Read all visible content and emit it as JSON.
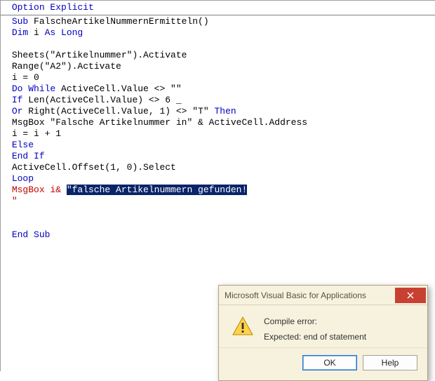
{
  "code": {
    "l01_a": "Option Explicit",
    "l02_a": "Sub",
    "l02_b": " FalscheArtikelNummernErmitteln()",
    "l03_a": "Dim",
    "l03_b": " i ",
    "l03_c": "As Long",
    "l05_a": "Sheets(\"Artikelnummer\").Activate",
    "l06_a": "Range(\"A2\").Activate",
    "l07_a": "i = 0",
    "l08_a": "Do While",
    "l08_b": " ActiveCell.Value <> \"\"",
    "l09_a": "If",
    "l09_b": " Len(ActiveCell.Value) <> 6 _",
    "l10_a": "Or",
    "l10_b": " Right(ActiveCell.Value, 1) <> \"T\" ",
    "l10_c": "Then",
    "l11_a": "MsgBox \"Falsche Artikelnummer in\" & ActiveCell.Address",
    "l12_a": "i = i + 1",
    "l13_a": "Else",
    "l14_a": "End If",
    "l15_a": "ActiveCell.Offset(1, 0).Select",
    "l16_a": "Loop",
    "l17_a": "MsgBox i& ",
    "l17_b": "\"falsche Artikelnummern gefunden!",
    "l18_a": "\"",
    "l21_a": "End Sub"
  },
  "dialog": {
    "title": "Microsoft Visual Basic for Applications",
    "line1": "Compile error:",
    "line2": "Expected: end of statement",
    "ok": "OK",
    "help": "Help"
  }
}
